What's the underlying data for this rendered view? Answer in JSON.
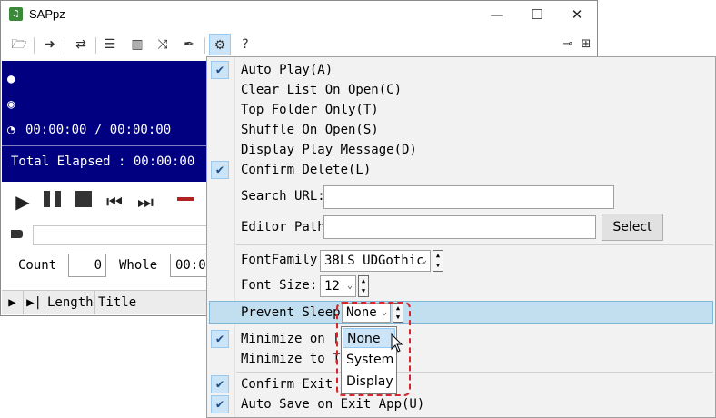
{
  "window": {
    "title": "SAPpz",
    "app_icon_glyph": "♫",
    "minimize_glyph": "—",
    "maximize_glyph": "☐",
    "close_glyph": "✕"
  },
  "toolbar": {
    "icons": [
      "folder-open-icon",
      "arrow-right-icon",
      "repeat-icon",
      "list-icon",
      "barcode-icon",
      "shuffle-icon",
      "pen-icon",
      "gear-icon",
      "help-icon"
    ],
    "glyphs": [
      "🗁",
      "➜",
      "⇄",
      "☰",
      "▥",
      "⤨",
      "✒",
      "⚙",
      "?"
    ],
    "pin_glyph": "⊸",
    "layout_glyph": "⊞"
  },
  "player": {
    "artist_glyph": "●",
    "album_glyph": "◉",
    "clock_glyph": "◔",
    "time_display": "00:00:00  /  00:00:00",
    "total_elapsed": "Total Elapsed : 00:00:00"
  },
  "controls": {
    "play": "▶",
    "prev": "⏮",
    "next": "⏭"
  },
  "counters": {
    "count_label": "Count",
    "count_value": "0",
    "whole_label": "Whole",
    "whole_value": "00:0"
  },
  "list_header": {
    "play_col": "▶",
    "next_col": "▶|",
    "length": "Length",
    "title": "Title"
  },
  "menu": {
    "check_glyph": "✔",
    "auto_play": "Auto Play(A)",
    "clear_list": "Clear List On Open(C)",
    "top_folder": "Top Folder Only(T)",
    "shuffle_on_open": "Shuffle On Open(S)",
    "display_play_message": "Display Play Message(D)",
    "confirm_delete": "Confirm Delete(L)",
    "search_url_label": "Search URL:",
    "search_url_value": "",
    "editor_path_label": "Editor Path",
    "editor_path_value": "",
    "select_button": "Select",
    "font_family_label": "FontFamily:",
    "font_family_value": "38LS UDGothic",
    "font_size_label": "Font Size:",
    "font_size_value": "12",
    "prevent_sleep_label": "Prevent Sleep:",
    "prevent_sleep_value": "None",
    "minimize_on_esc": "Minimize on [Es",
    "minimize_to_task": "Minimize to Tas",
    "confirm_exit": "Confirm Exit Ap",
    "auto_save_on_exit": "Auto Save on Exit App(U)",
    "checked": {
      "auto_play": true,
      "confirm_delete": true,
      "minimize_on_esc": true,
      "confirm_exit": true,
      "auto_save_on_exit": true
    }
  },
  "prevent_sleep_options": [
    "None",
    "System",
    "Display"
  ],
  "prevent_sleep_selected": "None"
}
